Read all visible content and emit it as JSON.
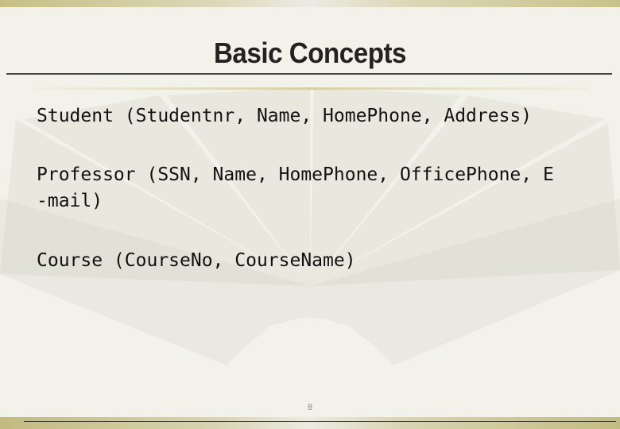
{
  "slide": {
    "title": "Basic Concepts",
    "items": [
      "Student (Studentnr, Name, HomePhone, Address)",
      "Professor (SSN, Name, HomePhone, OfficePhone, E\n-mail)",
      "Course (CourseNo, CourseName)"
    ],
    "page_number": "8"
  },
  "theme": {
    "background": "#f3f2ea",
    "bar_color": "#c6bf85",
    "text_color": "#111111"
  }
}
